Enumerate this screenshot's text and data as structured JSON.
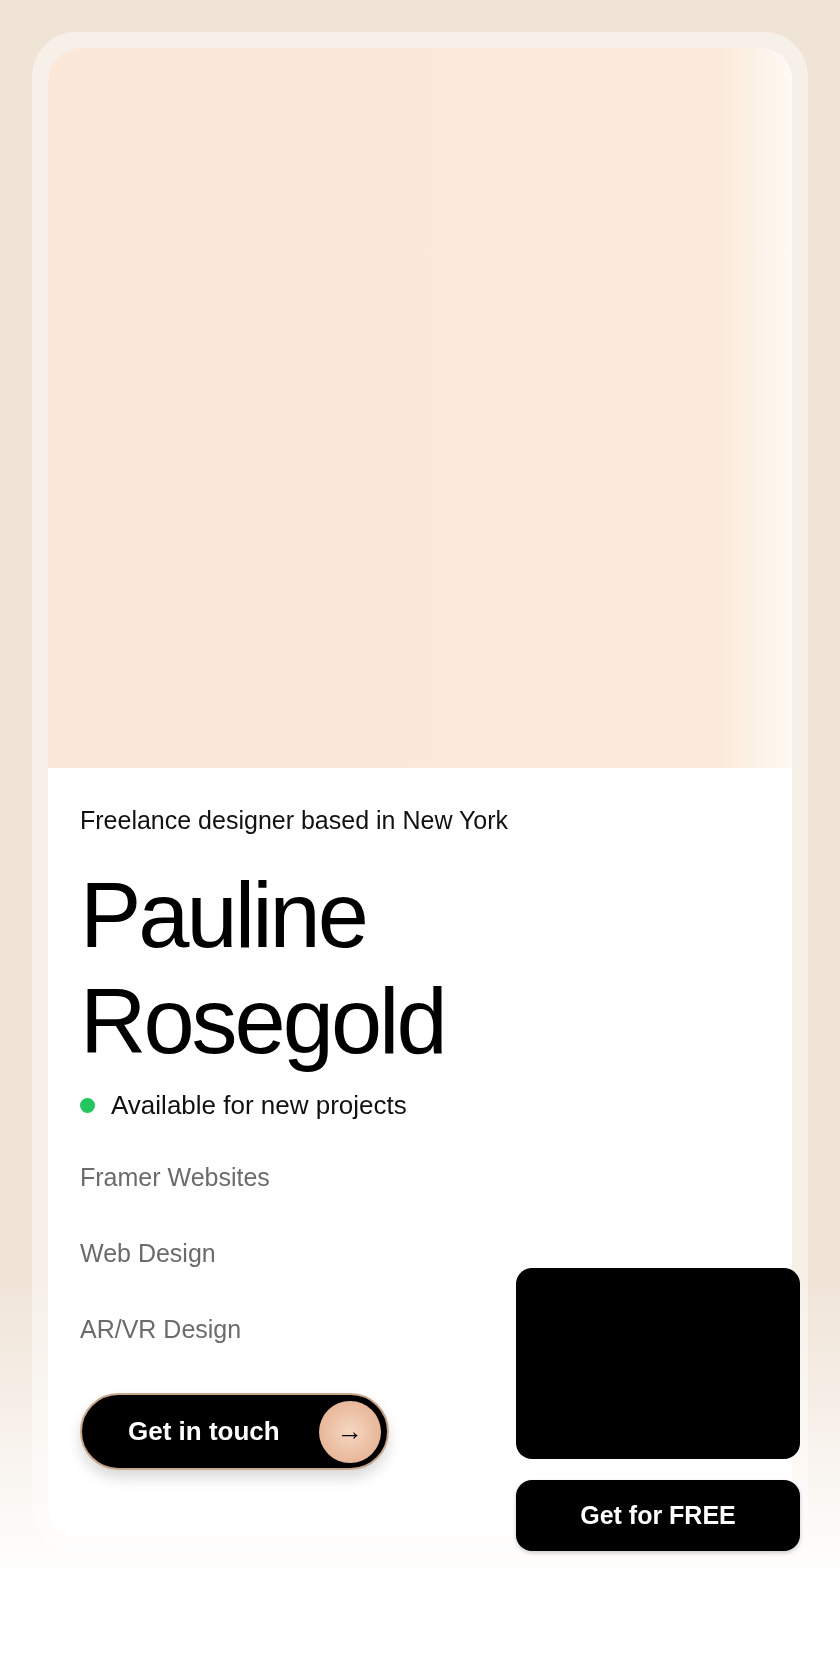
{
  "tagline": "Freelance designer based in New York",
  "name_lines": [
    "Pauline",
    "Rosegold"
  ],
  "status": {
    "text": "Available for new projects",
    "color": "#22c55e"
  },
  "services": [
    "Framer Websites",
    "Web Design",
    "AR/VR Design"
  ],
  "contact_button": {
    "label": "Get in touch",
    "icon": "→"
  },
  "promo_button": {
    "label": "Get for FREE"
  }
}
